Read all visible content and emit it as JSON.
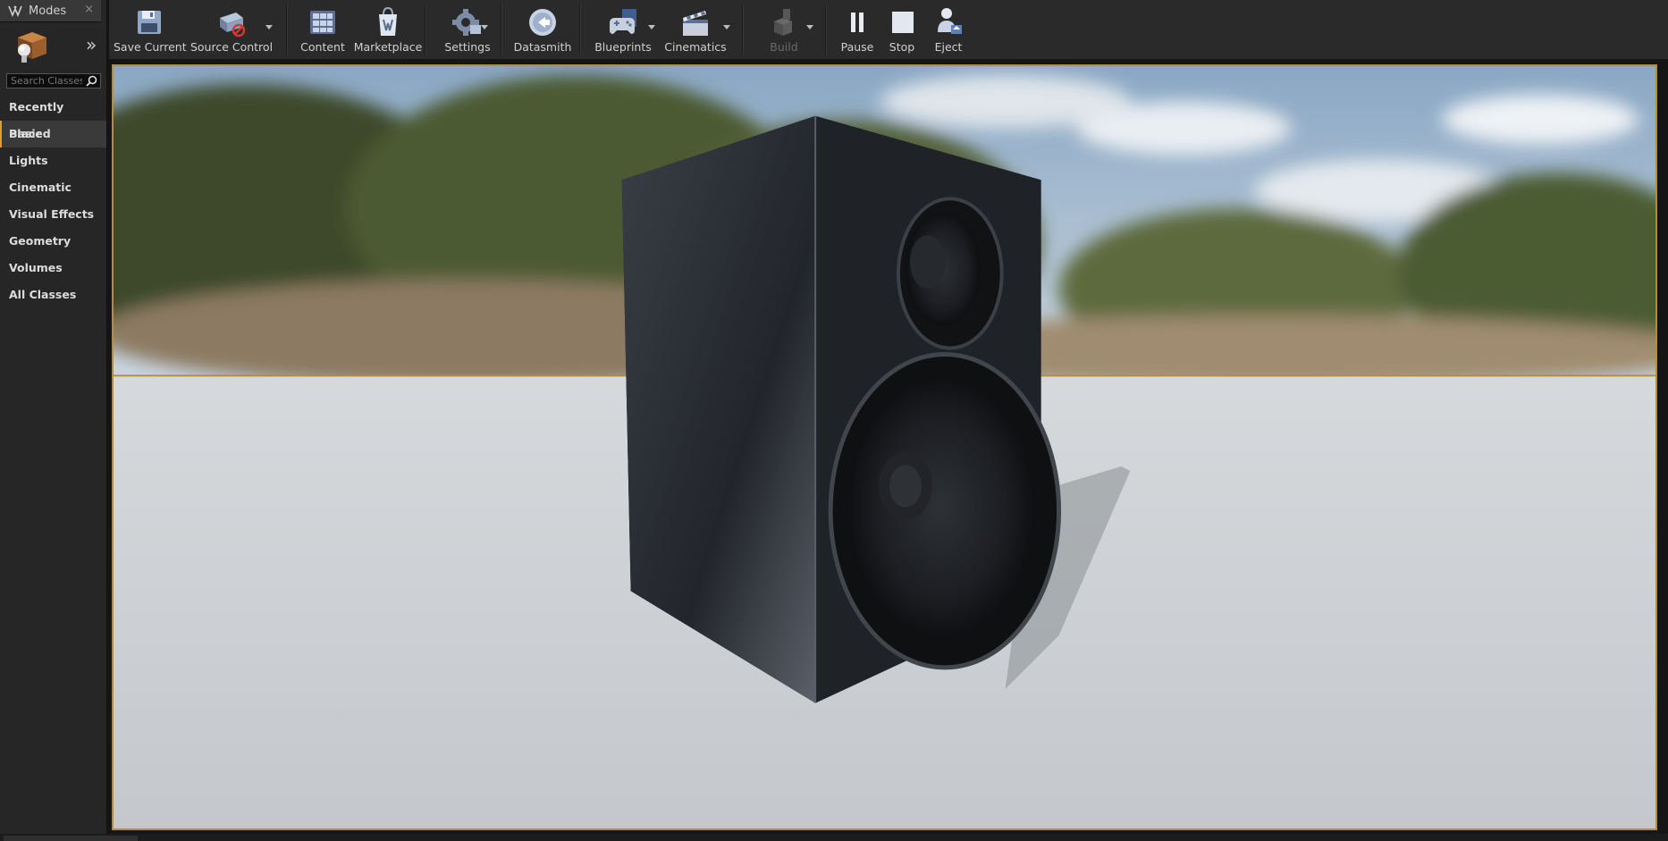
{
  "modes": {
    "title": "Modes",
    "close_glyph": "×",
    "expand_glyph": "»",
    "search_placeholder": "Search Classes",
    "categories": [
      {
        "label": "Recently Placed"
      },
      {
        "label": "Basic"
      },
      {
        "label": "Lights"
      },
      {
        "label": "Cinematic"
      },
      {
        "label": "Visual Effects"
      },
      {
        "label": "Geometry"
      },
      {
        "label": "Volumes"
      },
      {
        "label": "All Classes"
      }
    ],
    "active_category": "Basic"
  },
  "toolbar": {
    "save_current": "Save Current",
    "source_control": "Source Control",
    "content": "Content",
    "marketplace": "Marketplace",
    "settings": "Settings",
    "datasmith": "Datasmith",
    "blueprints": "Blueprints",
    "cinematics": "Cinematics",
    "build": "Build",
    "pause": "Pause",
    "stop": "Stop",
    "eject": "Eject"
  },
  "icons": {
    "save": "floppy-disk-icon",
    "source_control": "source-control-icon",
    "content": "content-browser-icon",
    "marketplace": "marketplace-icon",
    "settings": "gear-icon",
    "datasmith": "datasmith-icon",
    "blueprints": "blueprint-controller-icon",
    "cinematics": "clapperboard-icon",
    "build": "build-icon",
    "pause": "pause-icon",
    "stop": "stop-icon",
    "eject": "eject-icon"
  },
  "colors": {
    "accent": "#e39a2e",
    "viewport_border": "#b28d3a",
    "panel_bg": "#262626",
    "toolbar_bg": "#2a2a2a"
  }
}
